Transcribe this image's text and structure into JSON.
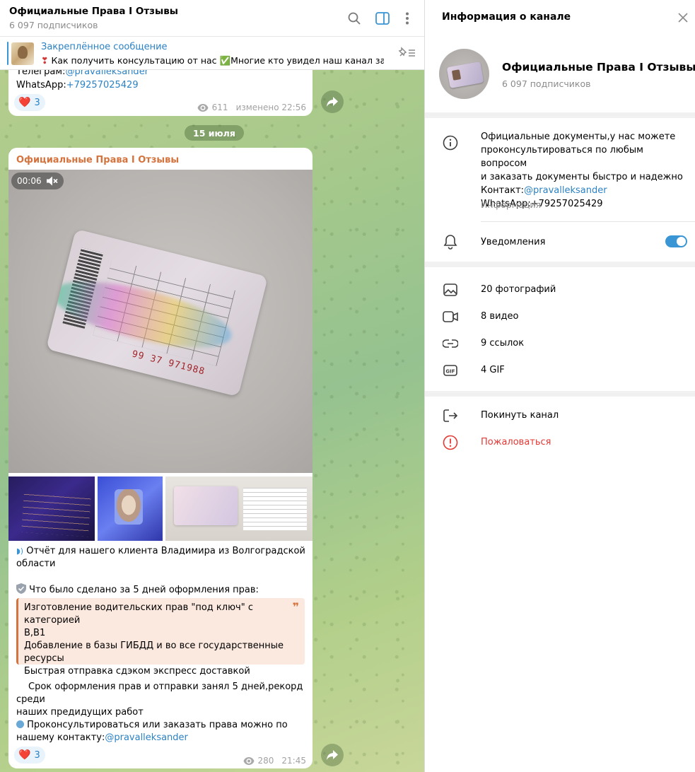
{
  "chat": {
    "title": "Официальные Права I Отзывы",
    "subscribers": "6 097 подписчиков",
    "pinned": {
      "title": "Закреплённое сообщение",
      "text": "Как получить консультацию от нас ✅Многие кто увидел наш канал за..."
    },
    "msg1": {
      "line1_prefix": "Телеграм:",
      "line1_link": "@pravalleksander",
      "line2_prefix": "WhatsApp:",
      "line2_link": "+79257025429",
      "reaction_emoji": "❤️",
      "reaction_count": "3",
      "views": "611",
      "edited": "изменено 22:56"
    },
    "date_separator": "15 июля",
    "msg2": {
      "sender": "Официальные Права I Отзывы",
      "video_duration": "00:06",
      "card_number": "99 37  971988",
      "para1_line1": "Отчёт для нашего клиента Владимира из Волгоградской",
      "para1_line2": "области",
      "para2": "Что было сделано за 5 дней оформления прав:",
      "quote_lines": [
        "Изготовление водительских прав \"под ключ\" с категорией",
        "B,B1",
        "Добавление в базы ГИБДД и во все государственные",
        "ресурсы",
        "Быстрая отправка сдэком экспресс доставкой"
      ],
      "para3_line1": "Срок оформления прав и отправки занял 5 дней,рекорд среди",
      "para3_line2": "наших предидущих работ",
      "para4_line1": "Проконсультироваться или заказать права можно по",
      "para4_line2_prefix": "нашему контакту:",
      "para4_link": "@pravalleksander",
      "reaction_emoji": "❤️",
      "reaction_count": "3",
      "views": "280",
      "time": "21:45"
    }
  },
  "info": {
    "title": "Информация о канале",
    "channel_name": "Официальные Права I Отзывы",
    "subscribers": "6 097 подписчиков",
    "description_lines": [
      "Официальные документы,у нас можете",
      "проконсультироваться по любым вопросом",
      "и заказать документы быстро и надежно"
    ],
    "contact_prefix": "Контакт:",
    "contact_link": "@pravalleksander",
    "whatsapp": "WhatsApp:+79257025429",
    "description_caption": "Информация",
    "notifications_label": "Уведомления",
    "notifications_on": true,
    "media": [
      {
        "icon": "photo-icon",
        "label": "20 фотографий"
      },
      {
        "icon": "video-icon",
        "label": "8 видео"
      },
      {
        "icon": "link-icon",
        "label": "9 ссылок"
      },
      {
        "icon": "gif-icon",
        "label": "4 GIF"
      }
    ],
    "leave_label": "Покинуть канал",
    "report_label": "Пожаловаться"
  },
  "colors": {
    "accent": "#3a95d5",
    "link": "#2b82c4",
    "sender": "#d4733d",
    "danger": "#e53935"
  }
}
